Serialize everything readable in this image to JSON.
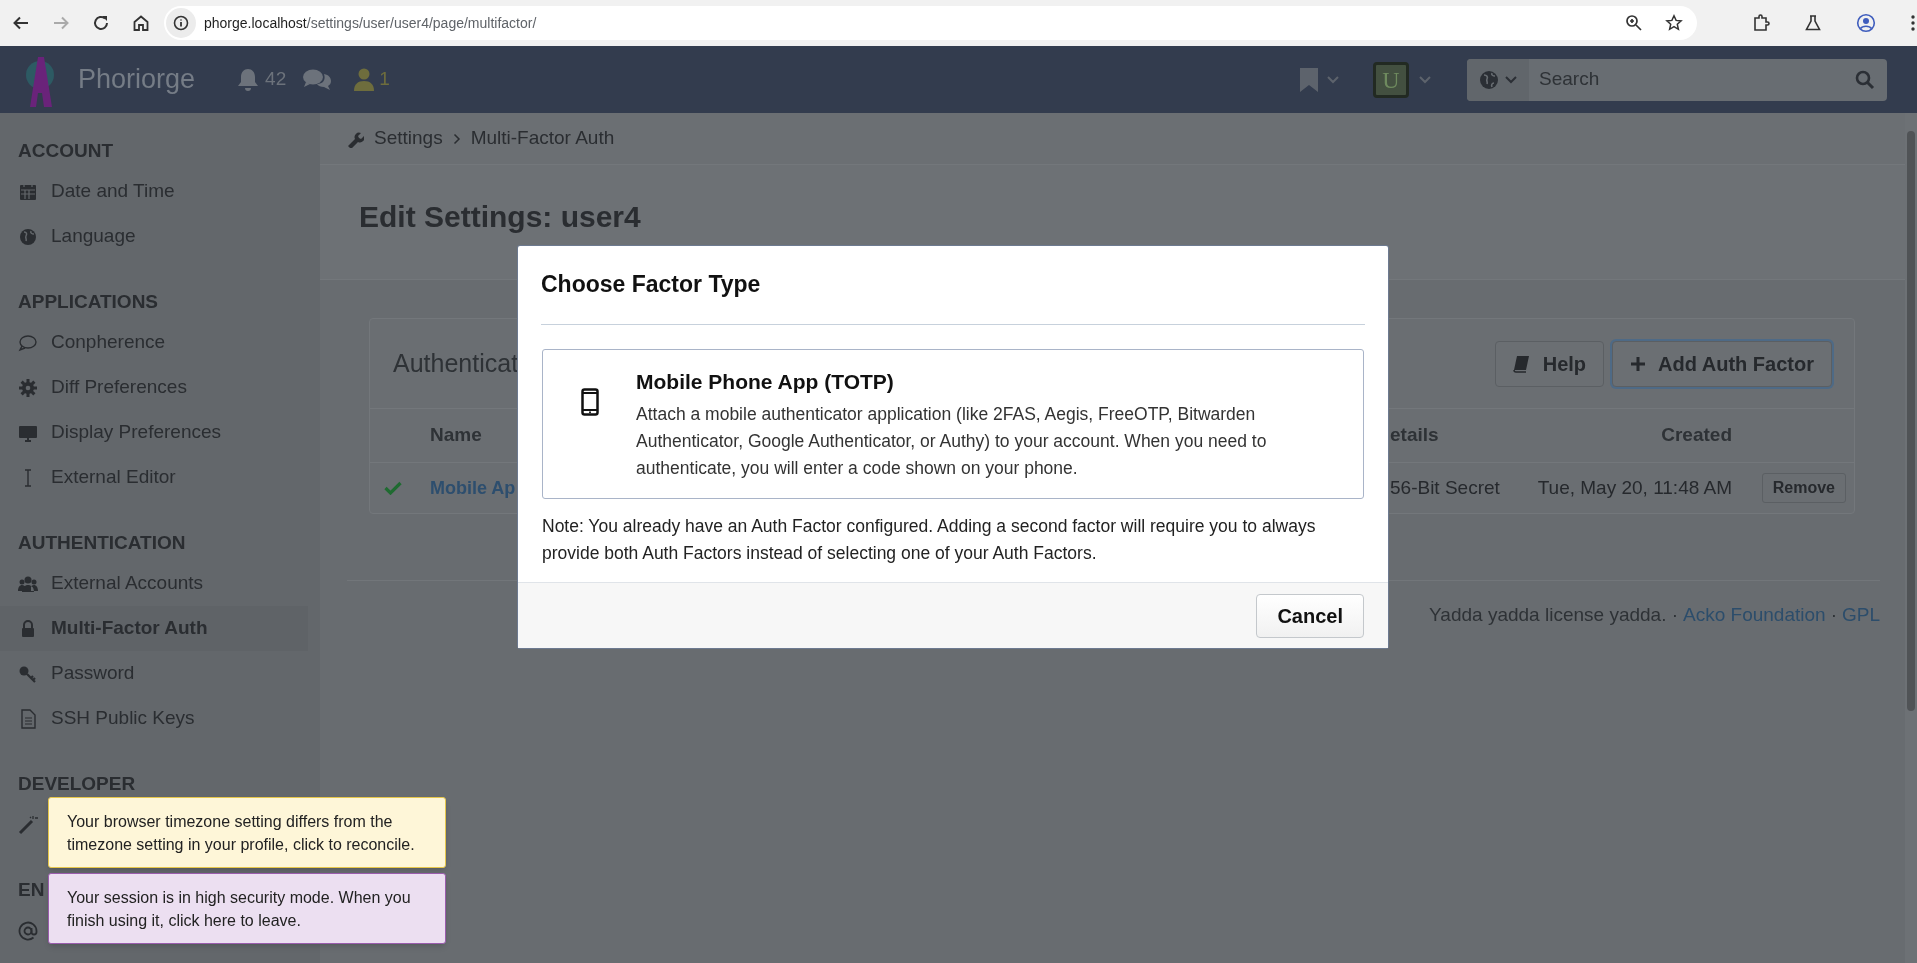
{
  "browser": {
    "url_host": "phorge.localhost",
    "url_path": "/settings/user/user4/page/multifactor/"
  },
  "header": {
    "app_name": "Phoriorge",
    "notification_count": "42",
    "user_count": "1",
    "avatar_letter": "U",
    "search": {
      "placeholder": "Search"
    }
  },
  "breadcrumbs": [
    {
      "label": "Settings"
    },
    {
      "label": "Multi-Factor Auth"
    }
  ],
  "page_title": "Edit Settings: user4",
  "sidebar": {
    "sections": [
      {
        "heading": "ACCOUNT",
        "items": [
          {
            "label": "Date and Time",
            "selected": false
          },
          {
            "label": "Language",
            "selected": false
          }
        ]
      },
      {
        "heading": "APPLICATIONS",
        "items": [
          {
            "label": "Conpherence",
            "selected": false
          },
          {
            "label": "Diff Preferences",
            "selected": false
          },
          {
            "label": "Display Preferences",
            "selected": false
          },
          {
            "label": "External Editor",
            "selected": false
          }
        ]
      },
      {
        "heading": "AUTHENTICATION",
        "items": [
          {
            "label": "External Accounts",
            "selected": false
          },
          {
            "label": "Multi-Factor Auth",
            "selected": true
          },
          {
            "label": "Password",
            "selected": false
          },
          {
            "label": "SSH Public Keys",
            "selected": false
          }
        ]
      },
      {
        "heading": "DEVELOPER"
      },
      {
        "heading": "EN"
      }
    ]
  },
  "panel": {
    "title": "Authenticat",
    "buttons": [
      {
        "kind": "help",
        "label": "Help",
        "focused": false
      },
      {
        "kind": "add",
        "label": "Add Auth Factor",
        "focused": true
      }
    ],
    "table": {
      "columns": [
        "Name",
        "etails",
        "Created"
      ],
      "rows": [
        {
          "enabled": true,
          "name": "Mobile Ap",
          "details": "56-Bit Secret",
          "created": "Tue, May 20, 11:48 AM",
          "action": "Remove"
        }
      ]
    }
  },
  "footer": [
    {
      "kind": "text",
      "text": "Yadda yadda license yadda. ·"
    },
    {
      "kind": "link",
      "text": "Acko Foundation"
    },
    {
      "kind": "text",
      "text": "·"
    },
    {
      "kind": "link",
      "text": "GPL"
    }
  ],
  "dialog": {
    "title": "Choose Factor Type",
    "options": [
      {
        "title": "Mobile Phone App (TOTP)",
        "description": "Attach a mobile authenticator application (like 2FAS, Aegis, FreeOTP, Bitwarden Authenticator, Google Authenticator, or Authy) to your account. When you need to authenticate, you will enter a code shown on your phone."
      }
    ],
    "note": "Note: You already have an Auth Factor configured. Adding a second factor will require you to always provide both Auth Factors instead of selecting one of your Auth Factors.",
    "buttons": [
      {
        "label": "Cancel"
      }
    ]
  },
  "toasts": [
    {
      "kind": "warning",
      "text": "Your browser timezone setting differs from the timezone setting in your profile, click to reconcile."
    },
    {
      "kind": "security",
      "text": "Your session is in high security mode. When you finish using it, click here to leave."
    }
  ]
}
